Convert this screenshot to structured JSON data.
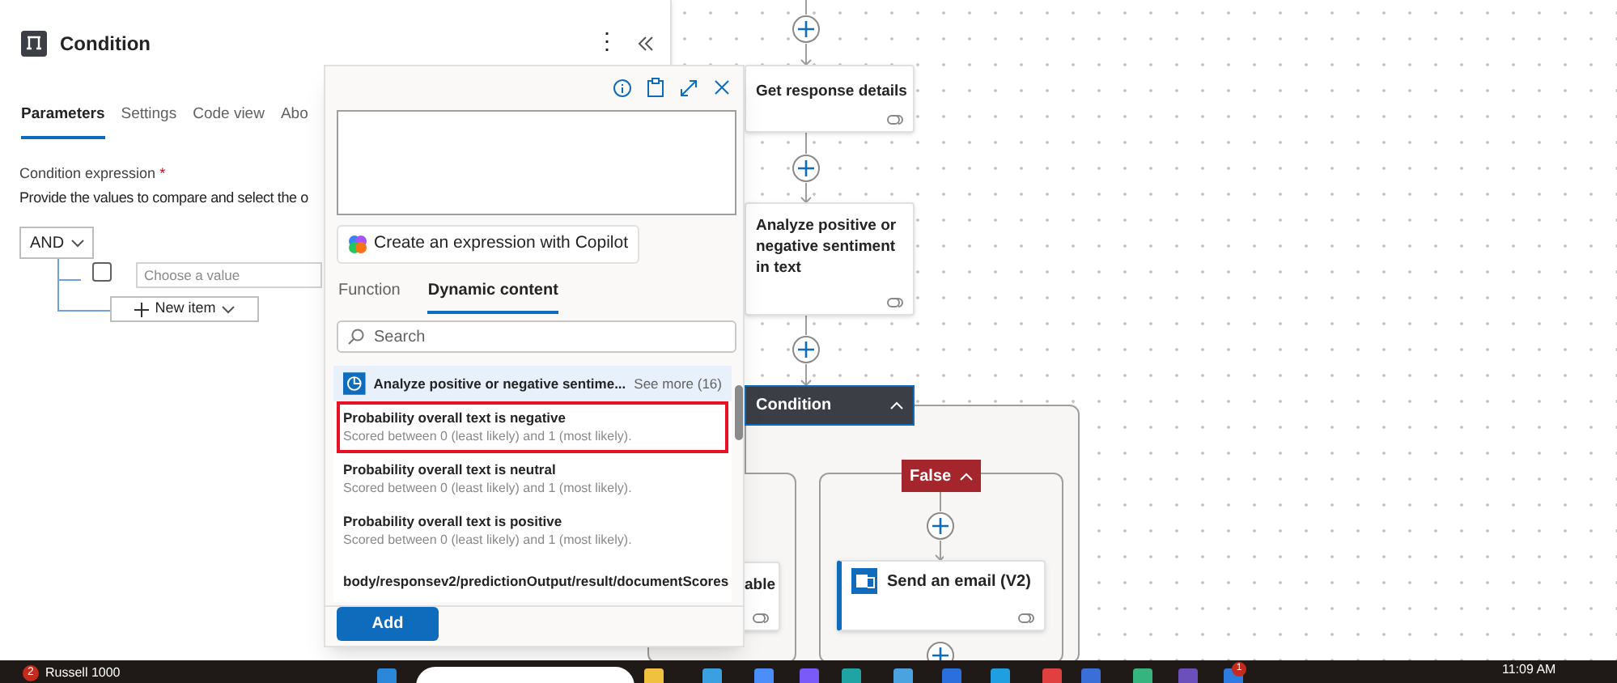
{
  "panel": {
    "title": "Condition",
    "more_button": "⋮",
    "checkbox_checked": false,
    "tabs": [
      {
        "label": "Parameters",
        "selected": true
      },
      {
        "label": "Settings",
        "selected": false
      },
      {
        "label": "Code view",
        "selected": false
      },
      {
        "label": "Abo",
        "selected": false
      }
    ],
    "field_label": "Condition expression",
    "required_mark": "*",
    "description": "Provide the values to compare and select the o",
    "operator": "AND",
    "value_placeholder": "Choose a value",
    "new_item_button": "New item"
  },
  "popup": {
    "copilot_button": "Create an expression with Copilot",
    "tabs": [
      {
        "label": "Function",
        "selected": false
      },
      {
        "label": "Dynamic content",
        "selected": true
      }
    ],
    "search_placeholder": "Search",
    "group": {
      "title": "Analyze positive or negative sentime...",
      "see_more": "See more (16)"
    },
    "items": [
      {
        "title": "Probability overall text is negative",
        "description": "Scored between 0 (least likely) and 1 (most likely).",
        "highlighted": true
      },
      {
        "title": "Probability overall text is neutral",
        "description": "Scored between 0 (least likely) and 1 (most likely).",
        "highlighted": false
      },
      {
        "title": "Probability overall text is positive",
        "description": "Scored between 0 (least likely) and 1 (most likely).",
        "highlighted": false
      },
      {
        "title": "body/responsev2/predictionOutput/result/documentScores",
        "highlighted": false
      }
    ],
    "add_button": "Add"
  },
  "canvas": {
    "actions": [
      {
        "title": "Get response details"
      },
      {
        "title": "Analyze positive or negative sentiment in text"
      }
    ],
    "condition": {
      "title": "Condition"
    },
    "true_branch": {
      "card_title": "able"
    },
    "false_branch": {
      "label": "False",
      "card_title": "Send an email (V2)"
    }
  },
  "taskbar": {
    "widget": "Russell 1000",
    "widget_badge": "2",
    "app_badge": "1",
    "clock": "11:09 AM"
  }
}
